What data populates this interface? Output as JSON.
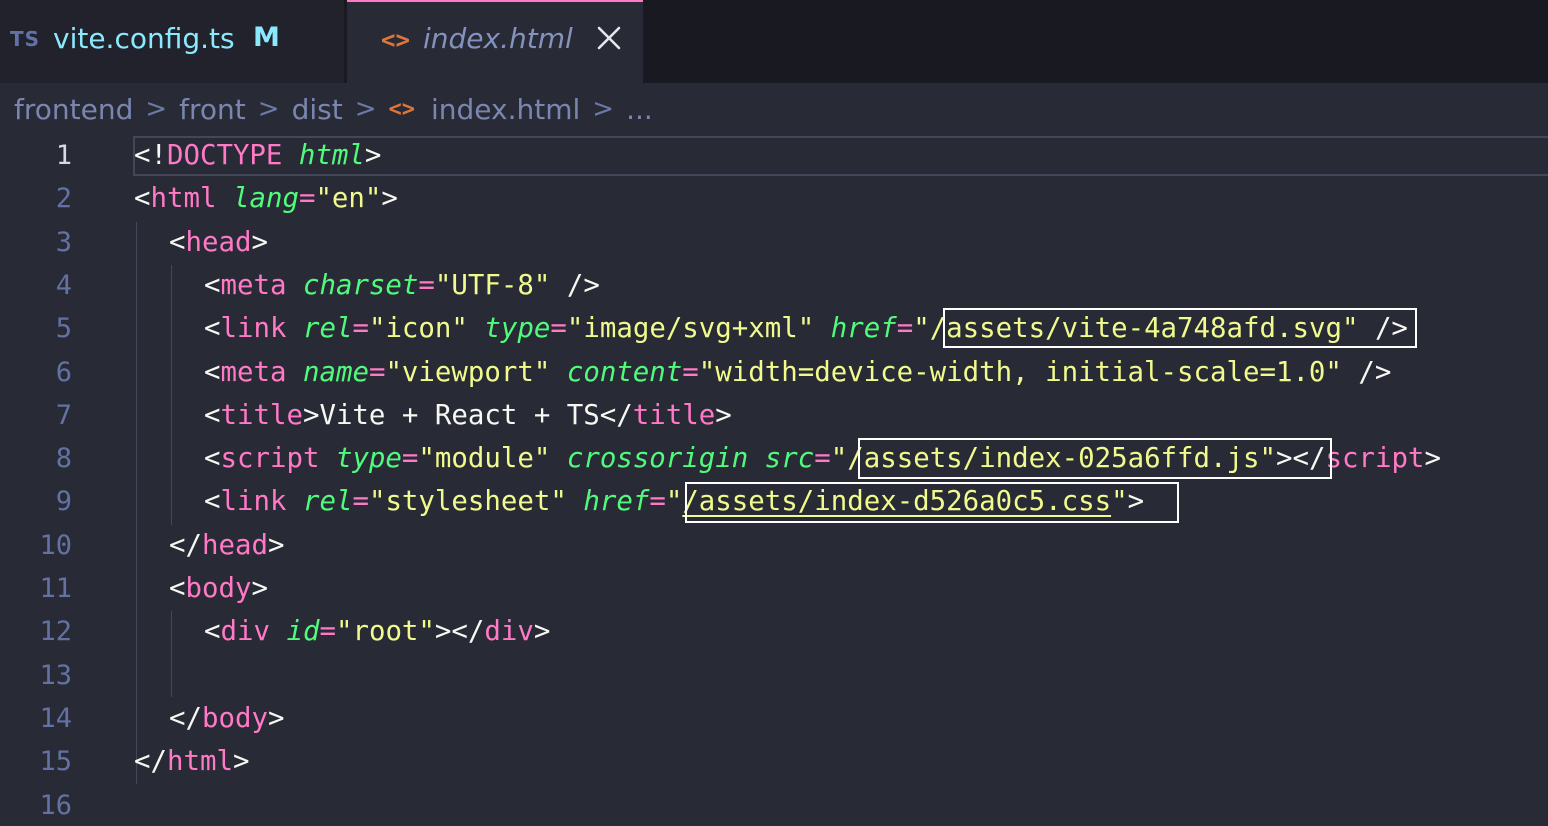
{
  "tabs": [
    {
      "icon": "TS",
      "label": "vite.config.ts",
      "badge": "M"
    },
    {
      "icon": "<>",
      "label": "index.html"
    }
  ],
  "breadcrumb": {
    "items": [
      "frontend",
      "front",
      "dist",
      "index.html",
      "..."
    ],
    "separator": ">"
  },
  "editor": {
    "active_line": 1,
    "line_numbers": [
      "1",
      "2",
      "3",
      "4",
      "5",
      "6",
      "7",
      "8",
      "9",
      "10",
      "11",
      "12",
      "13",
      "14",
      "15",
      "16"
    ],
    "tokens": {
      "l1": [
        "<!",
        "DOCTYPE",
        " ",
        "html",
        ">"
      ],
      "l2": [
        "<",
        "html",
        " ",
        "lang",
        "=",
        "\"en\"",
        ">"
      ],
      "l3": [
        "<",
        "head",
        ">"
      ],
      "l4": [
        "<",
        "meta",
        " ",
        "charset",
        "=",
        "\"UTF-8\"",
        " />"
      ],
      "l5": [
        "<",
        "link",
        " ",
        "rel",
        "=",
        "\"icon\"",
        " ",
        "type",
        "=",
        "\"image/svg+xml\"",
        " ",
        "href",
        "=",
        "\"/assets/vite-4a748afd.svg\"",
        " />"
      ],
      "l6": [
        "<",
        "meta",
        " ",
        "name",
        "=",
        "\"viewport\"",
        " ",
        "content",
        "=",
        "\"width=device-width, initial-scale=1.0\"",
        " />"
      ],
      "l7": [
        "<",
        "title",
        ">",
        "Vite + React + TS",
        "</",
        "title",
        ">"
      ],
      "l8": [
        "<",
        "script",
        " ",
        "type",
        "=",
        "\"module\"",
        " ",
        "crossorigin",
        " ",
        "src",
        "=",
        "\"/assets/index-025a6ffd.js\"",
        "></",
        "script",
        ">"
      ],
      "l9": [
        "<",
        "link",
        " ",
        "rel",
        "=",
        "\"stylesheet\"",
        " ",
        "href",
        "=",
        "\"",
        "/assets/index-d526a0c5.css",
        "\"",
        ">"
      ],
      "l10": [
        "</",
        "head",
        ">"
      ],
      "l11": [
        "<",
        "body",
        ">"
      ],
      "l12": [
        "<",
        "div",
        " ",
        "id",
        "=",
        "\"root\"",
        "></",
        "div",
        ">"
      ],
      "l14": [
        "</",
        "body",
        ">"
      ],
      "l15": [
        "</",
        "html",
        ">"
      ]
    }
  },
  "colors": {
    "background": "#282a36",
    "tag": "#ff79c6",
    "attribute": "#50fa7b",
    "string": "#f1fa8c",
    "text": "#f8f8f2",
    "line_number": "#6272a4",
    "ts_label": "#8be9fd",
    "html_icon": "#e0753a",
    "highlight_box": "#ffffff"
  },
  "icons": {
    "ts_file": "typescript-file-icon",
    "html_file": "html-code-icon",
    "close": "close-icon",
    "chevron": "chevron-right-icon"
  }
}
